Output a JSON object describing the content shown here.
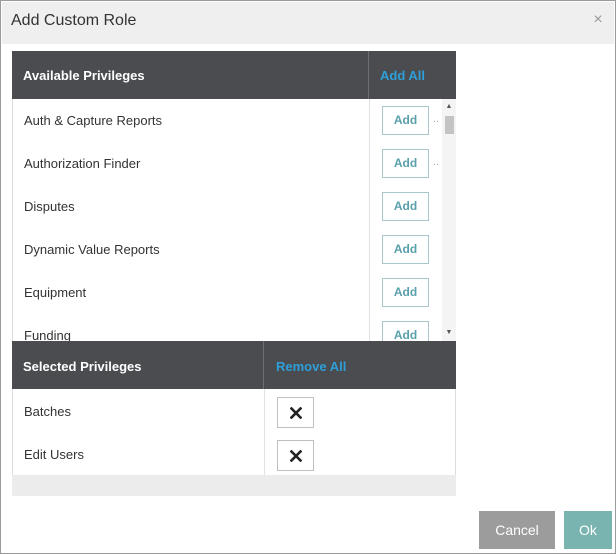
{
  "dialog": {
    "title": "Add Custom Role",
    "close_glyph": "×"
  },
  "available": {
    "header": "Available Privileges",
    "add_all": "Add All",
    "add_label": "Add",
    "items": [
      {
        "label": "Auth & Capture Reports"
      },
      {
        "label": "Authorization Finder"
      },
      {
        "label": "Disputes"
      },
      {
        "label": "Dynamic Value Reports"
      },
      {
        "label": "Equipment"
      },
      {
        "label": "Funding"
      }
    ],
    "scroll_up_glyph": "▲",
    "scroll_down_glyph": "▼"
  },
  "selected": {
    "header": "Selected Privileges",
    "remove_all": "Remove All",
    "items": [
      {
        "label": "Batches"
      },
      {
        "label": "Edit Users"
      }
    ]
  },
  "footer": {
    "cancel": "Cancel",
    "ok": "Ok"
  },
  "colors": {
    "header_bg": "#4a4c50",
    "link_blue": "#2e9fd8",
    "cancel_bg": "#9c9c9c",
    "ok_bg": "#79b4b0"
  },
  "icons": {
    "close": "close-icon",
    "remove": "x-icon",
    "scroll_up": "caret-up-icon",
    "scroll_down": "caret-down-icon"
  }
}
